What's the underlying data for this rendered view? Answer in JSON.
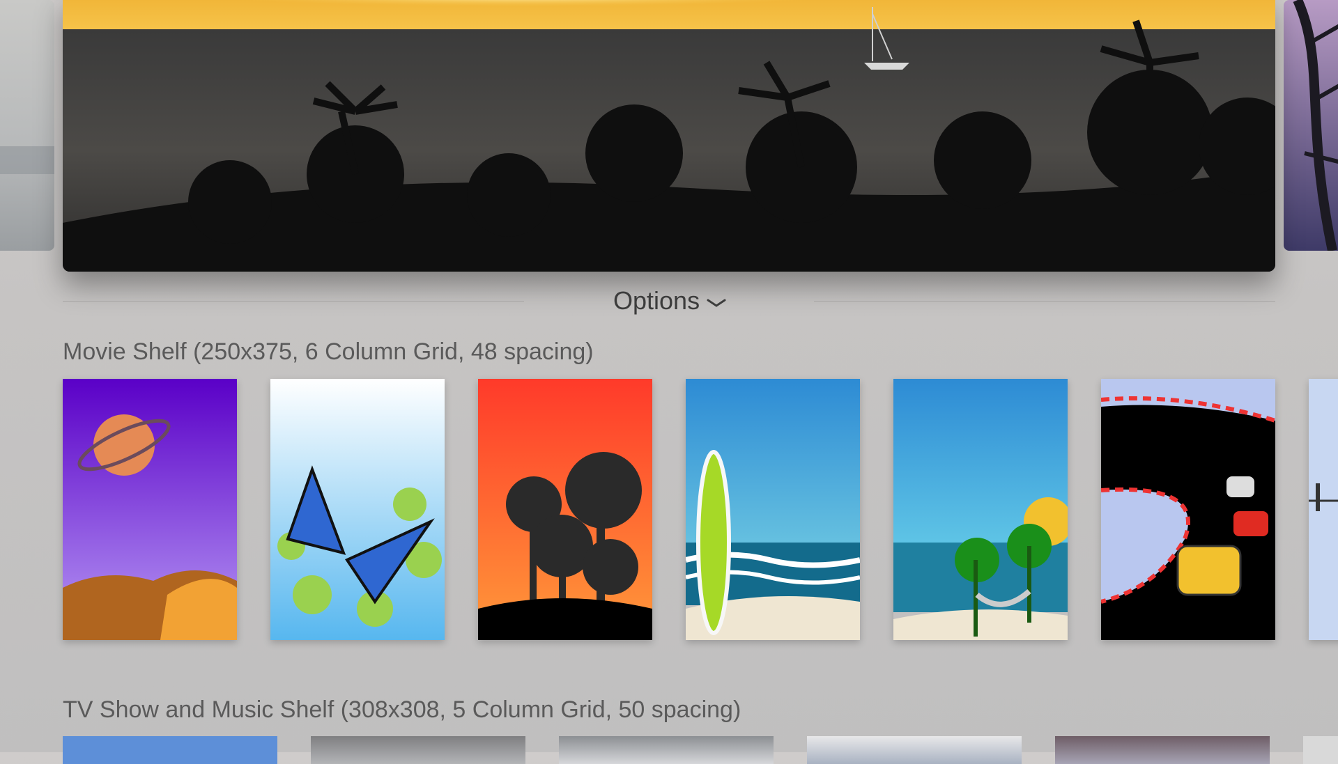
{
  "options": {
    "label": "Options",
    "chevron": "chevron-down-icon"
  },
  "movie_shelf": {
    "title": "Movie Shelf (250x375, 6 Column Grid, 48 spacing)",
    "items": [
      {
        "icon": "planet-icon"
      },
      {
        "icon": "butterfly-icon"
      },
      {
        "icon": "palm-trees-icon"
      },
      {
        "icon": "surfboard-icon"
      },
      {
        "icon": "hammock-icon"
      },
      {
        "icon": "race-car-icon"
      },
      {
        "icon": "bridge-icon"
      }
    ]
  },
  "tv_shelf": {
    "title": "TV Show and Music Shelf (308x308, 5 Column Grid, 50 spacing)"
  }
}
